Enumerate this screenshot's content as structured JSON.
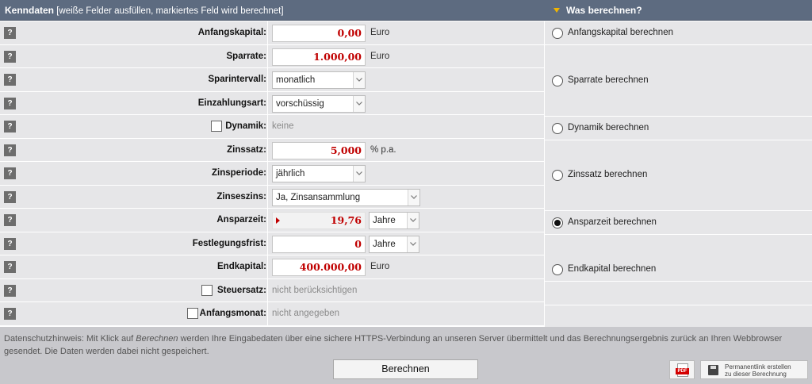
{
  "header": {
    "title": "Kenndaten",
    "hint": "[weiße Felder ausfüllen, markiertes Feld wird berechnet]",
    "right_title": "Was berechnen?"
  },
  "help_glyph": "?",
  "fields": {
    "anfangskapital": {
      "label": "Anfangskapital:",
      "value": "0,00",
      "unit": "Euro"
    },
    "sparrate": {
      "label": "Sparrate:",
      "value": "1.000,00",
      "unit": "Euro"
    },
    "sparintervall": {
      "label": "Sparintervall:",
      "selected": "monatlich"
    },
    "einzahlungsart": {
      "label": "Einzahlungsart:",
      "selected": "vorschüssig"
    },
    "dynamik": {
      "label": "Dynamik:",
      "value": "keine",
      "checked": false
    },
    "zinssatz": {
      "label": "Zinssatz:",
      "value": "5,000",
      "unit": "% p.a."
    },
    "zinsperiode": {
      "label": "Zinsperiode:",
      "selected": "jährlich"
    },
    "zinseszins": {
      "label": "Zinseszins:",
      "selected": "Ja, Zinsansammlung"
    },
    "ansparzeit": {
      "label": "Ansparzeit:",
      "value": "19,76",
      "unit_selected": "Jahre"
    },
    "festlegungsfrist": {
      "label": "Festlegungsfrist:",
      "value": "0",
      "unit_selected": "Jahre"
    },
    "endkapital": {
      "label": "Endkapital:",
      "value": "400.000,00",
      "unit": "Euro"
    },
    "steuersatz": {
      "label": "Steuersatz:",
      "value": "nicht berücksichtigen",
      "checked": false
    },
    "anfangsmonat": {
      "label": "Anfangsmonat:",
      "value": "nicht angegeben",
      "checked": false
    }
  },
  "calc_options": [
    {
      "label": "Anfangskapital berechnen",
      "selected": false
    },
    {
      "label": "Sparrate berechnen",
      "selected": false
    },
    {
      "label": "Dynamik berechnen",
      "selected": false
    },
    {
      "label": "Zinssatz berechnen",
      "selected": false
    },
    {
      "label": "Ansparzeit berechnen",
      "selected": true
    },
    {
      "label": "Endkapital berechnen",
      "selected": false
    }
  ],
  "footer": {
    "privacy_prefix": "Datenschutzhinweis: Mit Klick auf ",
    "privacy_em": "Berechnen",
    "privacy_suffix": " werden Ihre Eingabedaten über eine sichere HTTPS-Verbindung an unseren Server übermittelt und das Berechnungsergebnis zurück an Ihren Webbrowser gesendet. Die Daten werden dabei nicht gespeichert.",
    "calc_button": "Berechnen",
    "pdf_label": "PDF",
    "permalink_line1": "Permanentlink erstellen",
    "permalink_line2": "zu dieser Berechnung"
  },
  "colors": {
    "header_bg": "#5d6b80",
    "row_bg": "#e6e6e8",
    "value_red": "#c00000",
    "footer_bg": "#c8c8cc",
    "arrow_yellow": "#f0b400"
  }
}
